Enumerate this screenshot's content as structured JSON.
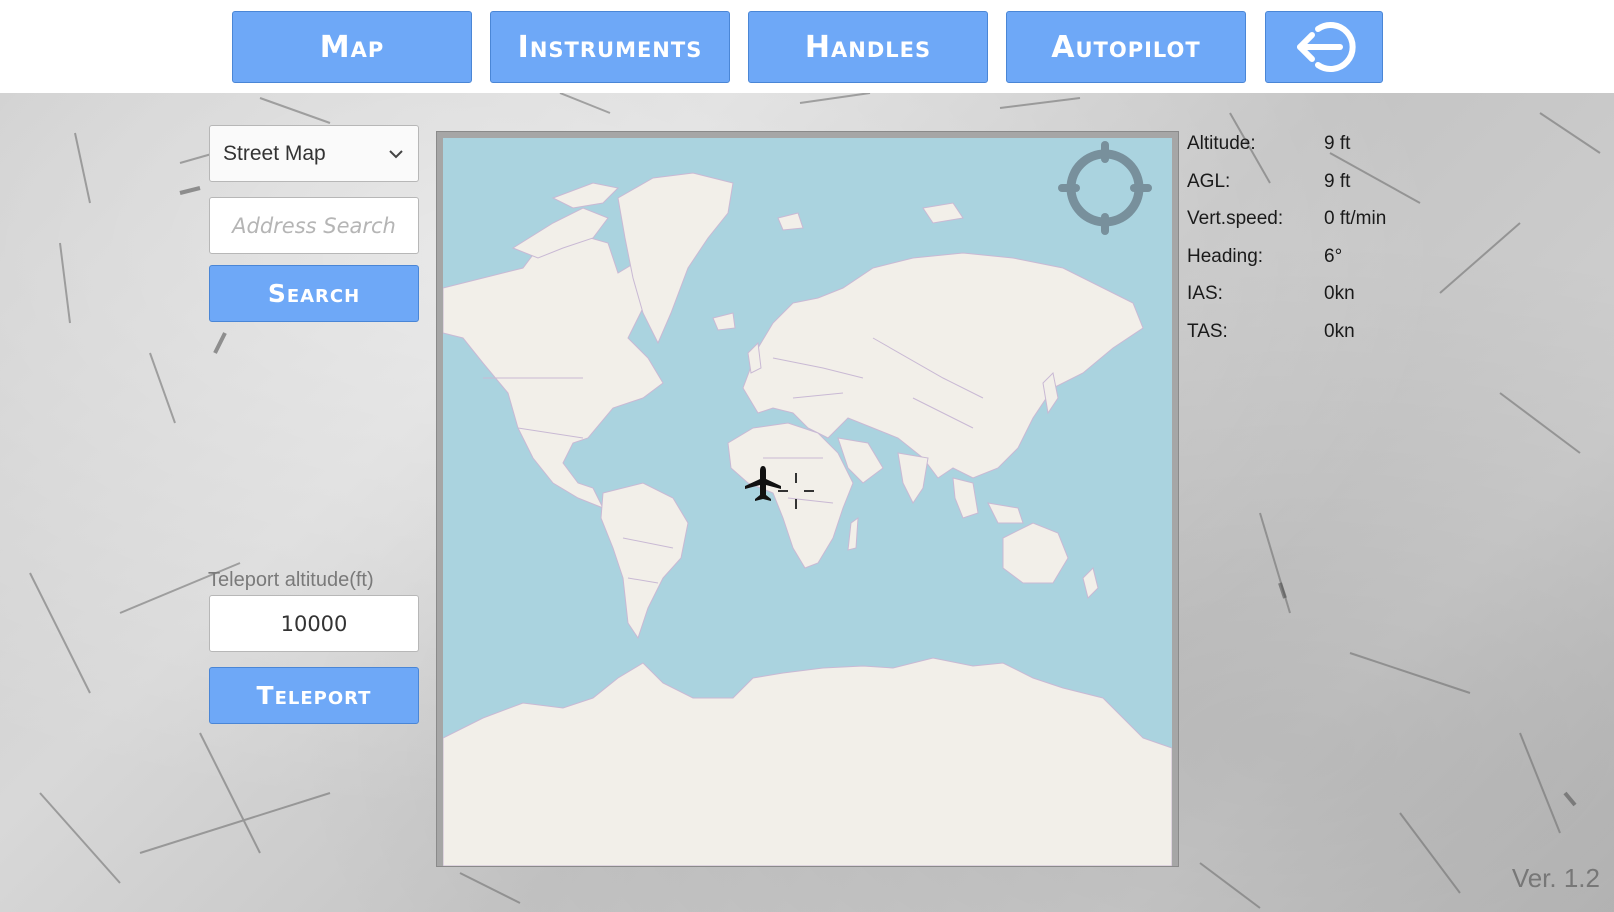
{
  "nav": {
    "map_label": "Map",
    "instruments_label": "Instruments",
    "handles_label": "Handles",
    "autopilot_label": "Autopilot",
    "exit_icon": "exit-arrow-icon"
  },
  "left_panel": {
    "map_type_selected": "Street Map",
    "address_placeholder": "Address Search",
    "search_label": "Search",
    "teleport_altitude_label": "Teleport altitude(ft)",
    "teleport_altitude_value": "10000",
    "teleport_label": "Teleport"
  },
  "map": {
    "locate_icon": "crosshair-target-icon",
    "aircraft_icon": "airplane-icon",
    "center_marker_icon": "center-crosshair-icon"
  },
  "telemetry": [
    {
      "label": "Altitude:",
      "value": "9 ft"
    },
    {
      "label": "AGL:",
      "value": "9 ft"
    },
    {
      "label": "Vert.speed:",
      "value": "0 ft/min"
    },
    {
      "label": "Heading:",
      "value": "6°"
    },
    {
      "label": "IAS:",
      "value": "0kn"
    },
    {
      "label": "TAS:",
      "value": "0kn"
    }
  ],
  "version": "Ver. 1.2",
  "colors": {
    "button_blue": "#6ea8f7",
    "ocean": "#aad3df",
    "land": "#f2efe9",
    "border": "#c9b9d4"
  }
}
